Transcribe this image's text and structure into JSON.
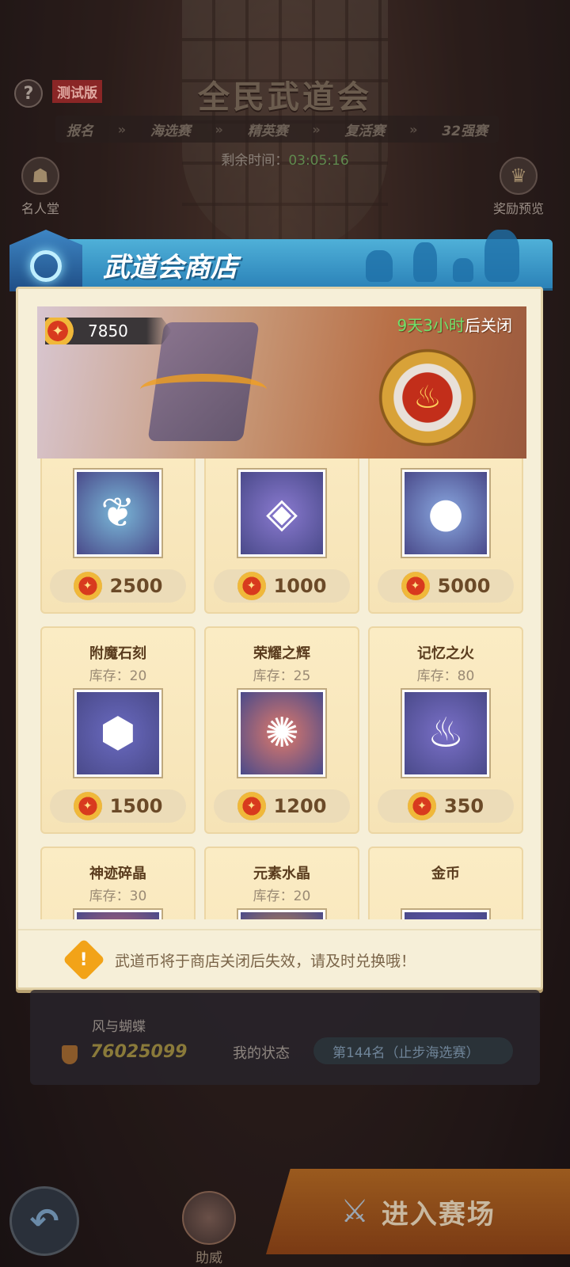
{
  "header": {
    "help_label": "?",
    "beta_badge": "测试版",
    "title": "全民武道会",
    "stages": [
      "报名",
      "海选赛",
      "精英赛",
      "复活赛",
      "32强赛"
    ],
    "countdown_label": "剩余时间：",
    "countdown_value": "03:05:16",
    "hall_of_fame": "名人堂",
    "reward_preview": "奖励预览"
  },
  "shop": {
    "title": "武道会商店",
    "balance": "7850",
    "close_time_highlight": "9天3小时",
    "close_time_suffix": "后关闭",
    "items": [
      {
        "name": "",
        "stock": "",
        "price": "2500",
        "icon": "jade-pendant-icon",
        "color": "#7ab8d8"
      },
      {
        "name": "",
        "stock": "",
        "price": "1000",
        "icon": "crystal-orb-icon",
        "color": "#8a7ad0"
      },
      {
        "name": "",
        "stock": "",
        "price": "5000",
        "icon": "mystic-fruit-icon",
        "color": "#8aa8e0"
      },
      {
        "name": "附魔石刻",
        "stock": "库存：20",
        "price": "1500",
        "icon": "rune-stone-icon",
        "color": "#6a6ac0"
      },
      {
        "name": "荣耀之辉",
        "stock": "库存：25",
        "price": "1200",
        "icon": "glory-orb-icon",
        "color": "#e07a6a"
      },
      {
        "name": "记忆之火",
        "stock": "库存：80",
        "price": "350",
        "icon": "memory-flame-icon",
        "color": "#7a70c8"
      },
      {
        "name": "神迹碎晶",
        "stock": "库存：30",
        "price": "",
        "icon": "miracle-shard-icon",
        "color": "#d86a6a"
      },
      {
        "name": "元素水晶",
        "stock": "库存：20",
        "price": "",
        "icon": "element-crystal-icon",
        "color": "#e89a3a"
      },
      {
        "name": "金币",
        "stock": "",
        "price": "",
        "icon": "gold-coin-icon",
        "color": "#6a5ab8"
      }
    ],
    "notice": "武道币将于商店关闭后失效，请及时兑换哦！"
  },
  "lower": {
    "player_name": "风与蝴蝶",
    "score": "76025099",
    "status_label": "我的状态",
    "status_value": "第144名（止步海选赛）",
    "cheer_label": "助威",
    "enter_label": "进入赛场"
  },
  "colors": {
    "accent_blue": "#2b82b8",
    "panel_bg": "#f6efd8",
    "highlight_green": "#6fe06a",
    "price_brown": "#6b4a28"
  }
}
